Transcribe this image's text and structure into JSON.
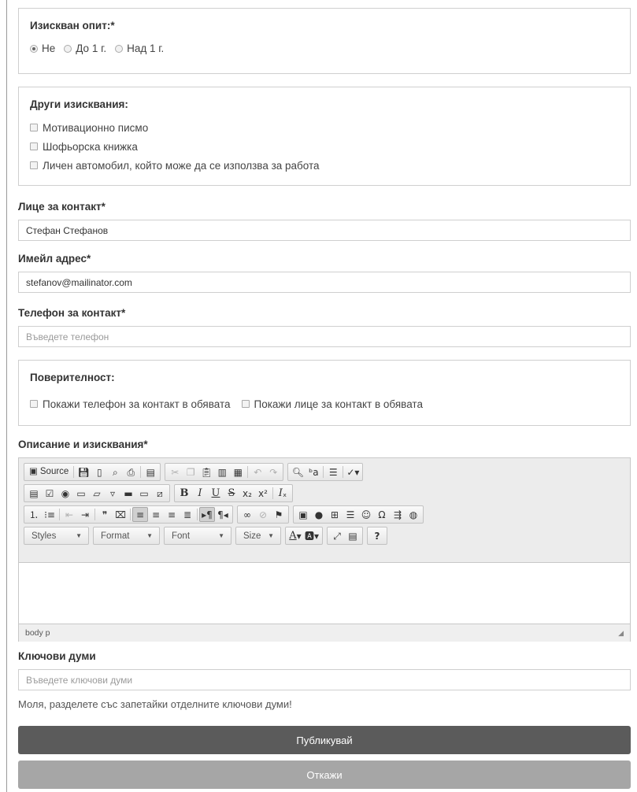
{
  "experience": {
    "title": "Изискван опит:*",
    "options": [
      {
        "label": "Не",
        "checked": true
      },
      {
        "label": "До 1 г.",
        "checked": false
      },
      {
        "label": "Над 1 г.",
        "checked": false
      }
    ]
  },
  "other": {
    "title": "Други изисквания:",
    "options": [
      "Мотивационно писмо",
      "Шофьорска книжка",
      "Личен автомобил, който може да се използва за работа"
    ]
  },
  "contact_person": {
    "label": "Лице за контакт*",
    "value": "Стефан Стефанов"
  },
  "email": {
    "label": "Имейл адрес*",
    "value": "stefanov@mailinator.com"
  },
  "phone": {
    "label": "Телефон за контакт*",
    "placeholder": "Въведете телефон",
    "value": ""
  },
  "privacy": {
    "title": "Поверителност:",
    "options": [
      "Покажи телефон за контакт в обявата",
      "Покажи лице за контакт в обявата"
    ]
  },
  "description": {
    "label": "Описание и изисквания*",
    "toolbar": {
      "source": "Source",
      "styles": "Styles",
      "format": "Format",
      "font": "Font",
      "size": "Size",
      "help": "?"
    },
    "status_path": "body  p"
  },
  "keywords": {
    "label": "Ключови думи",
    "placeholder": "Въведете ключови думи",
    "hint": "Моля, разделете със запетайки отделните ключови думи!"
  },
  "actions": {
    "publish": "Публикувай",
    "cancel": "Откажи"
  },
  "colors": {
    "primary_button": "#5b5b5b",
    "secondary_button": "#a6a6a6",
    "border": "#cfcfcf"
  }
}
